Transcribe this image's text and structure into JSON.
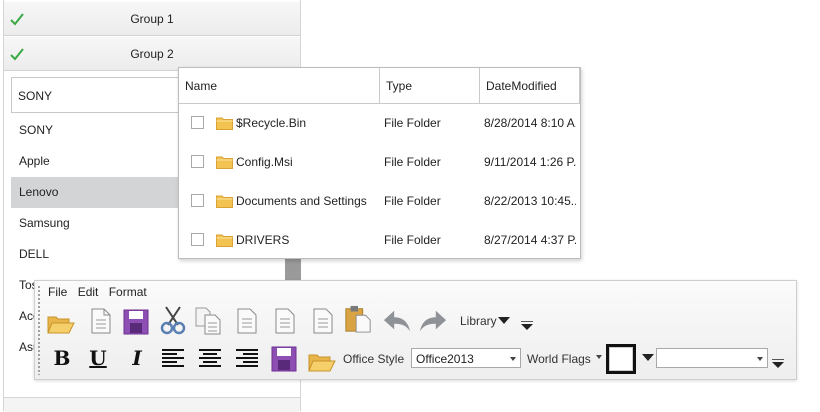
{
  "accordion": {
    "groups": [
      {
        "label": "Group 1"
      },
      {
        "label": "Group 2"
      }
    ],
    "combo_value": "SONY",
    "items": [
      "SONY",
      "Apple",
      "Lenovo",
      "Samsung",
      "DELL",
      "Tos",
      "Ace",
      "Asu"
    ],
    "selected_item": "Lenovo"
  },
  "grid": {
    "columns": [
      "Name",
      "Type",
      "DateModified"
    ],
    "rows": [
      {
        "name": "$Recycle.Bin",
        "type": "File Folder",
        "date": "8/28/2014 8:10 A..."
      },
      {
        "name": "Config.Msi",
        "type": "File Folder",
        "date": "9/11/2014 1:26 P..."
      },
      {
        "name": "Documents and Settings",
        "type": "File Folder",
        "date": "8/22/2013 10:45..."
      },
      {
        "name": "DRIVERS",
        "type": "File Folder",
        "date": "8/27/2014 4:37 P..."
      }
    ]
  },
  "toolbar": {
    "menu": [
      "File",
      "Edit",
      "Format"
    ],
    "library_label": "Library",
    "office_style_label": "Office Style",
    "office_style_value": "Office2013",
    "world_flags_label": "World Flags",
    "flag_combo_value": "",
    "icons": [
      "open-folder-icon",
      "new-document-icon",
      "save-icon",
      "cut-icon",
      "copy-icon",
      "document-icon",
      "document-icon",
      "document-icon",
      "paste-icon",
      "undo-icon",
      "redo-icon",
      "bold-icon",
      "underline-icon",
      "italic-icon",
      "align-left-icon",
      "align-center-icon",
      "align-right-icon"
    ]
  },
  "colors": {
    "accent_purple": "#8e4fb5",
    "folder_yellow": "#f2c350",
    "check_green": "#3aa845",
    "selection_gray": "#d3d4d6"
  }
}
